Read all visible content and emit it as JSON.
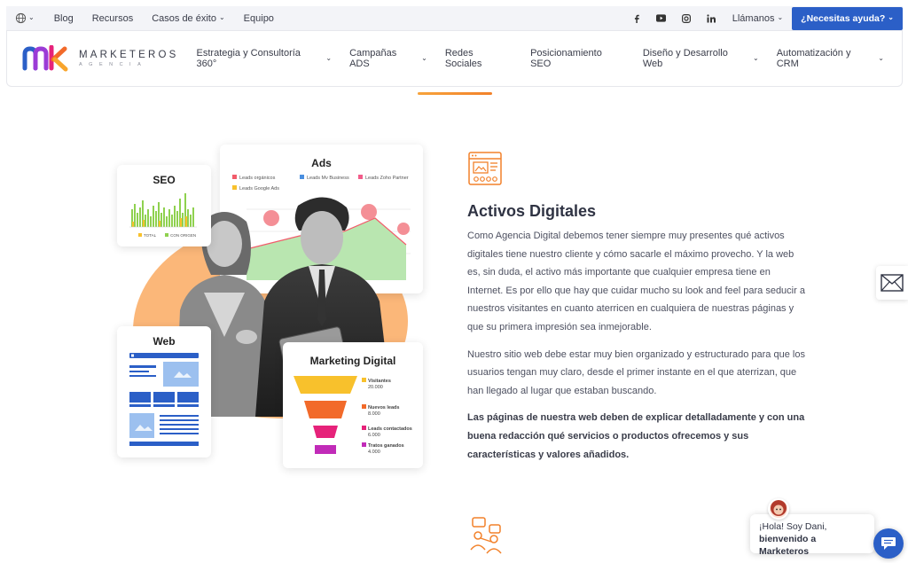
{
  "topbar": {
    "links": [
      "Blog",
      "Recursos",
      "Casos de éxito",
      "Equipo"
    ],
    "call_label": "Llámanos",
    "help_label": "¿Necesitas ayuda?",
    "social_icons": [
      "facebook-icon",
      "youtube-icon",
      "instagram-icon",
      "linkedin-icon"
    ]
  },
  "logo": {
    "name": "MARKETEROS",
    "sub": "AGENCIA"
  },
  "nav": {
    "items": [
      "Estrategia y Consultoría 360°",
      "Campañas ADS",
      "Redes Sociales",
      "Posicionamiento SEO",
      "Diseño y Desarrollo Web",
      "Automatización y CRM"
    ]
  },
  "illustration": {
    "seo_title": "SEO",
    "seo_legend": [
      "TOTAL",
      "CON ORIGEN"
    ],
    "ads_title": "Ads",
    "ads_legend": [
      "Leads orgánicos",
      "Leads Mv Business",
      "Leads Zoho Partner",
      "Leads Google Ads"
    ],
    "web_title": "Web",
    "funnel_title": "Marketing Digital",
    "funnel": [
      {
        "label": "Visitantes",
        "value": "20.000",
        "color": "#f8c12c"
      },
      {
        "label": "Nuevos leads",
        "value": "8.000",
        "color": "#f26a2a"
      },
      {
        "label": "Leads contactados",
        "value": "6.000",
        "color": "#e6227a"
      },
      {
        "label": "Tratos ganados",
        "value": "4.000",
        "color": "#c12bb8"
      }
    ]
  },
  "section": {
    "title": "Activos Digitales",
    "p1": "Como Agencia Digital debemos tener siempre muy presentes qué activos digitales tiene nuestro cliente y cómo sacarle el máximo provecho. Y la web es, sin duda, el activo más importante que cualquier empresa tiene en Internet. Es por ello que hay que cuidar mucho su look and feel para seducir a nuestros visitantes en cuanto aterricen en cualquiera de nuestras páginas y que su primera impresión sea inmejorable.",
    "p2": "Nuestro sitio web debe estar muy bien organizado y estructurado para que los usuarios tengan muy claro, desde el primer instante en el que aterrizan, que han llegado al lugar que estaban buscando.",
    "p3": "Las páginas de nuestra web deben de explicar detalladamente y con una buena redacción qué servicios o productos ofrecemos y sus características y valores añadidos."
  },
  "chat": {
    "greeting": "¡Hola! Soy Dani,",
    "welcome": "bienvenido a Marketeros"
  },
  "colors": {
    "accent": "#2b5fc7",
    "orange": "#f7a33b"
  }
}
